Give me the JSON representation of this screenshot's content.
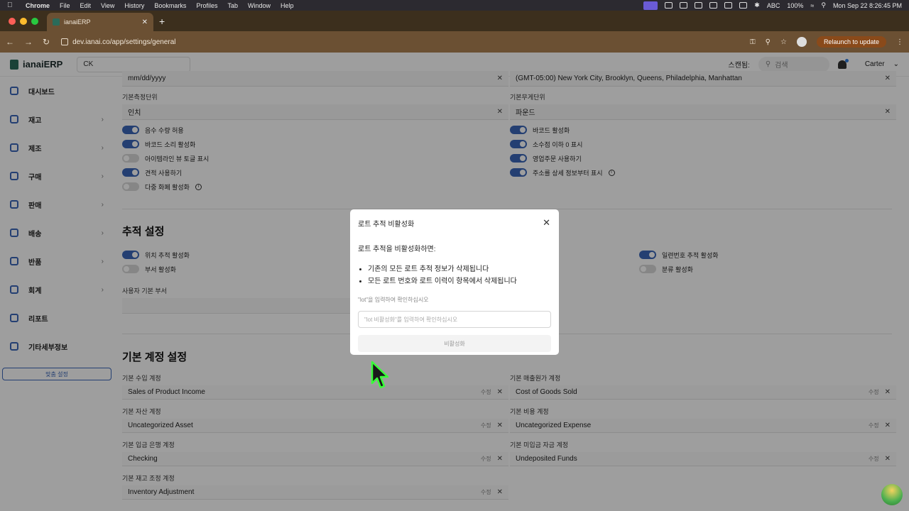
{
  "menubar": {
    "app": "Chrome",
    "items": [
      "File",
      "Edit",
      "View",
      "History",
      "Bookmarks",
      "Profiles",
      "Tab",
      "Window",
      "Help"
    ],
    "status": {
      "input": "ABC",
      "battery": "100%",
      "datetime": "Mon Sep 22  8:26:45 PM"
    }
  },
  "browser": {
    "tab_title": "ianaiERP",
    "url": "dev.ianai.co/app/settings/general",
    "relaunch": "Relaunch to update"
  },
  "app": {
    "logo": "ianaiERP",
    "company": "CK",
    "scan_label": "스캔됨:",
    "search_placeholder": "검색",
    "user": "Carter"
  },
  "sidebar": {
    "items": [
      {
        "label": "대시보드",
        "chevron": false
      },
      {
        "label": "재고",
        "chevron": true
      },
      {
        "label": "제조",
        "chevron": true
      },
      {
        "label": "구매",
        "chevron": true
      },
      {
        "label": "판매",
        "chevron": true
      },
      {
        "label": "배송",
        "chevron": true
      },
      {
        "label": "반품",
        "chevron": true
      },
      {
        "label": "회계",
        "chevron": true
      },
      {
        "label": "리포트",
        "chevron": false
      },
      {
        "label": "기타세부정보",
        "chevron": false
      }
    ],
    "settings_button": "맞춤 설정"
  },
  "settings": {
    "date_format_value": "mm/dd/yyyy",
    "timezone_value": "(GMT-05:00) New York City, Brooklyn, Queens, Philadelphia, Manhattan",
    "measure_unit_label": "기본측정단위",
    "measure_unit_value": "인치",
    "weight_unit_label": "기본무게단위",
    "weight_unit_value": "파운드",
    "left_toggles": [
      {
        "label": "음수 수량 허용",
        "on": true
      },
      {
        "label": "바코드 소리 활성화",
        "on": true
      },
      {
        "label": "아이템라인 뷰 토글 표시",
        "on": false
      },
      {
        "label": "견적 사용하기",
        "on": true
      },
      {
        "label": "다중 화폐 활성화",
        "on": false
      }
    ],
    "right_toggles": [
      {
        "label": "바코드 활성화",
        "on": true
      },
      {
        "label": "소수점 이하 0 표시",
        "on": true
      },
      {
        "label": "영업주문 사용하기",
        "on": true
      },
      {
        "label": "주소를 상세 정보부터 표시",
        "on": true
      }
    ],
    "tracking_title": "추적 설정",
    "tracking_left": [
      {
        "label": "위치 추적 활성화",
        "on": true
      },
      {
        "label": "부서 활성화",
        "on": false
      }
    ],
    "tracking_right": [
      {
        "label": "일련번호 추적 활성화",
        "on": true
      },
      {
        "label": "분류 활성화",
        "on": false
      }
    ],
    "default_dept_label": "사용자 기본 부서",
    "accounts_title": "기본 계정 설정",
    "edit_label": "수정",
    "accounts": [
      {
        "label": "기본 수입 계정",
        "value": "Sales of Product Income"
      },
      {
        "label": "기본 매출원가 계정",
        "value": "Cost of Goods Sold"
      },
      {
        "label": "기본 자산 계정",
        "value": "Uncategorized Asset"
      },
      {
        "label": "기본 비용 계정",
        "value": "Uncategorized Expense"
      },
      {
        "label": "기본 입금 은행 계정",
        "value": "Checking"
      },
      {
        "label": "기본 미입금 자금 계정",
        "value": "Undeposited Funds"
      },
      {
        "label": "기본 재고 조정 계정",
        "value": "Inventory Adjustment"
      }
    ]
  },
  "modal": {
    "title": "로트 추적 비활성화",
    "intro": "로트 추적을 비활성화하면:",
    "bullets": [
      "기존의 모든 로트 추적 정보가 삭제됩니다",
      "모든 로트 번호와 로트 이력이 항목에서 삭제됩니다"
    ],
    "hint": "\"lot\"을 입력하여 확인하십시오",
    "input_placeholder": "\"lot 비활성화\"를 입력하여 확인하십시오",
    "confirm_button": "비활성화"
  }
}
